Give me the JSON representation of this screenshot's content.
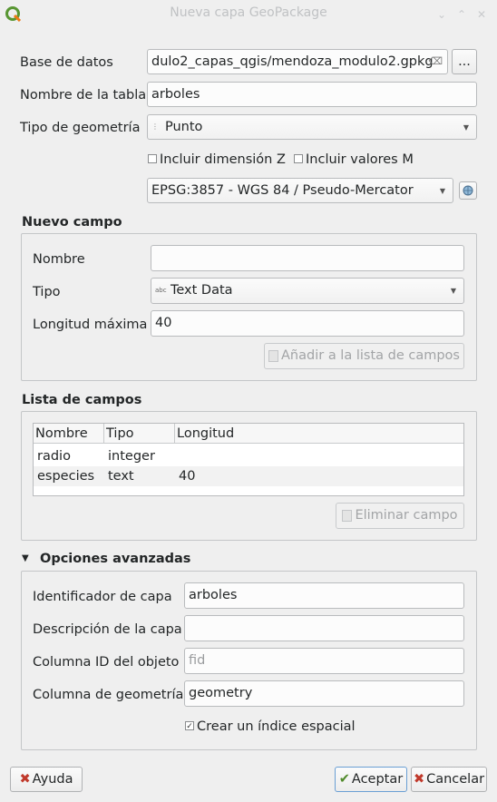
{
  "window": {
    "title": "Nueva capa GeoPackage"
  },
  "form": {
    "database": {
      "label": "Base de datos",
      "value": "dulo2_capas_qgis/mendoza_modulo2.gpkg",
      "browse_label": "..."
    },
    "table_name": {
      "label": "Nombre de la tabla",
      "value": "arboles"
    },
    "geometry_type": {
      "label": "Tipo de geometría",
      "value": "Punto"
    },
    "include_z": {
      "label": "Incluir dimensión Z",
      "checked": false
    },
    "include_m": {
      "label": "Incluir valores M",
      "checked": false
    },
    "crs": {
      "value": "EPSG:3857 - WGS 84 / Pseudo-Mercator"
    }
  },
  "new_field": {
    "section_title": "Nuevo campo",
    "name": {
      "label": "Nombre",
      "value": ""
    },
    "type": {
      "label": "Tipo",
      "value": "Text Data"
    },
    "max_length": {
      "label": "Longitud máxima",
      "value": "40"
    },
    "add_button": "Añadir a la lista de campos"
  },
  "field_list": {
    "section_title": "Lista de campos",
    "columns": [
      "Nombre",
      "Tipo",
      "Longitud"
    ],
    "rows": [
      {
        "name": "radio",
        "type": "integer",
        "length": ""
      },
      {
        "name": "especies",
        "type": "text",
        "length": "40"
      }
    ],
    "remove_button": "Eliminar campo"
  },
  "advanced": {
    "section_title": "Opciones avanzadas",
    "layer_id": {
      "label": "Identificador de capa",
      "value": "arboles"
    },
    "layer_description": {
      "label": "Descripción de la capa",
      "value": ""
    },
    "fid_column": {
      "label": "Columna ID del objeto",
      "placeholder": "fid"
    },
    "geometry_column": {
      "label": "Columna de geometría",
      "value": "geometry"
    },
    "spatial_index": {
      "label": "Crear un índice espacial",
      "checked": true
    }
  },
  "footer": {
    "help": "Ayuda",
    "accept": "Aceptar",
    "cancel": "Cancelar"
  },
  "colors": {
    "qgis_green": "#589632",
    "cancel_red": "#c0392b"
  }
}
